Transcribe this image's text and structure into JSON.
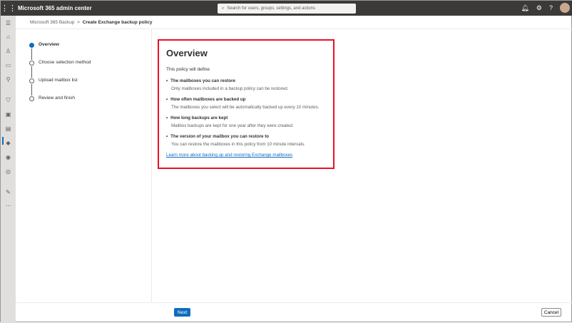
{
  "header": {
    "title": "Microsoft 365 admin center",
    "search_placeholder": "Search for users, groups, settings, and actions"
  },
  "breadcrumb": {
    "parent": "Microsoft 365 Backup",
    "separator": ">",
    "current": "Create Exchange backup policy"
  },
  "steps": [
    {
      "label": "Overview",
      "active": true
    },
    {
      "label": "Choose selection method"
    },
    {
      "label": "Upload mailbox list"
    },
    {
      "label": "Review and finish"
    }
  ],
  "overview": {
    "title": "Overview",
    "intro": "This policy will define",
    "items": [
      {
        "title": "The mailboxes you can restore",
        "desc": "Only mailboxes included in a backup policy can be restored."
      },
      {
        "title": "How often mailboxes are backed up",
        "desc": "The mailboxes you select will be automatically backed up every 10 minutes."
      },
      {
        "title": "How long backups are kept",
        "desc": "Mailbox backups are kept for one year after they were created."
      },
      {
        "title": "The version of your mailbox you can restore to",
        "desc": "You can restore the mailboxes in this policy from 10 minute intervals."
      }
    ],
    "link": "Learn more about backing up and restoring Exchange mailboxes"
  },
  "footer": {
    "next": "Next",
    "cancel": "Cancel"
  }
}
